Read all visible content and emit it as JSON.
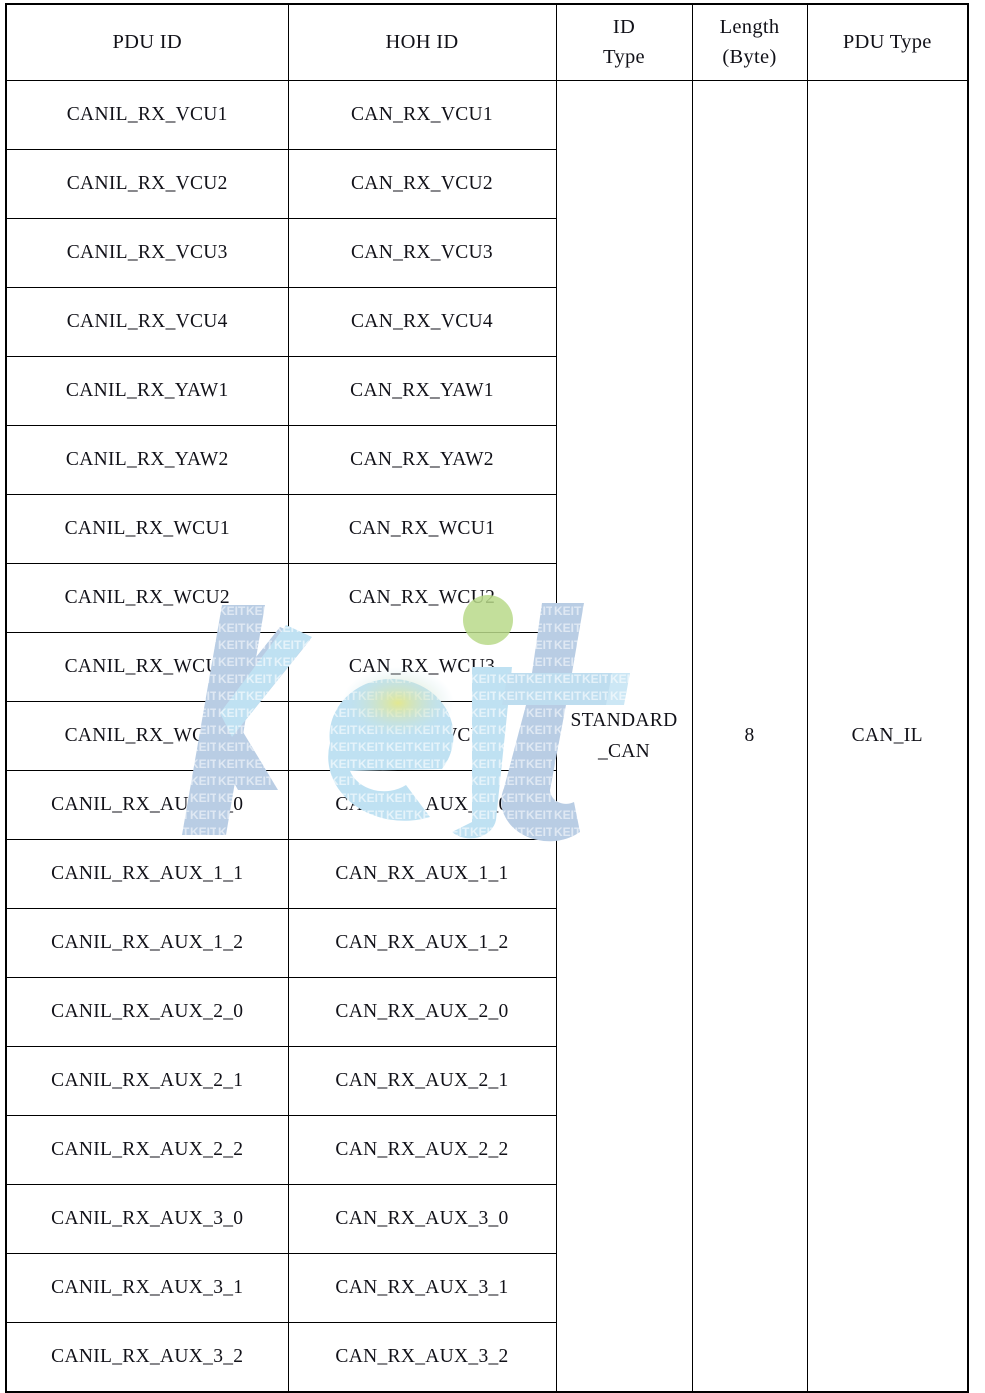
{
  "table": {
    "columns": [
      {
        "key": "pdu_id",
        "label": "PDU ID",
        "lines": [
          "PDU ID"
        ]
      },
      {
        "key": "hoh_id",
        "label": "HOH ID",
        "lines": [
          "HOH ID"
        ]
      },
      {
        "key": "id_type",
        "label": "ID Type",
        "lines": [
          "ID",
          "Type"
        ]
      },
      {
        "key": "length",
        "label": "Length (Byte)",
        "lines": [
          "Length",
          "(Byte)"
        ]
      },
      {
        "key": "pdu_type",
        "label": "PDU Type",
        "lines": [
          "PDU Type"
        ]
      }
    ],
    "header": {
      "pdu_id": "PDU ID",
      "hoh_id": "HOH ID",
      "id_type_line1": "ID",
      "id_type_line2": "Type",
      "length_line1": "Length",
      "length_line2": "(Byte)",
      "pdu_type": "PDU Type"
    },
    "merged": {
      "id_type_line1": "STANDARD",
      "id_type_line2": "_CAN",
      "length": "8",
      "pdu_type": "CAN_IL",
      "rowspan": 20
    },
    "rows": [
      {
        "pdu_id": "CANIL_RX_VCU1",
        "hoh_id": "CAN_RX_VCU1"
      },
      {
        "pdu_id": "CANIL_RX_VCU2",
        "hoh_id": "CAN_RX_VCU2"
      },
      {
        "pdu_id": "CANIL_RX_VCU3",
        "hoh_id": "CAN_RX_VCU3"
      },
      {
        "pdu_id": "CANIL_RX_VCU4",
        "hoh_id": "CAN_RX_VCU4"
      },
      {
        "pdu_id": "CANIL_RX_YAW1",
        "hoh_id": "CAN_RX_YAW1"
      },
      {
        "pdu_id": "CANIL_RX_YAW2",
        "hoh_id": "CAN_RX_YAW2"
      },
      {
        "pdu_id": "CANIL_RX_WCU1",
        "hoh_id": "CAN_RX_WCU1"
      },
      {
        "pdu_id": "CANIL_RX_WCU2",
        "hoh_id": "CAN_RX_WCU2"
      },
      {
        "pdu_id": "CANIL_RX_WCU3",
        "hoh_id": "CAN_RX_WCU3"
      },
      {
        "pdu_id": "CANIL_RX_WCU4",
        "hoh_id": "CAN_RX_WCU4"
      },
      {
        "pdu_id": "CANIL_RX_AUX_1_0",
        "hoh_id": "CAN_RX_AUX_1_0"
      },
      {
        "pdu_id": "CANIL_RX_AUX_1_1",
        "hoh_id": "CAN_RX_AUX_1_1"
      },
      {
        "pdu_id": "CANIL_RX_AUX_1_2",
        "hoh_id": "CAN_RX_AUX_1_2"
      },
      {
        "pdu_id": "CANIL_RX_AUX_2_0",
        "hoh_id": "CAN_RX_AUX_2_0"
      },
      {
        "pdu_id": "CANIL_RX_AUX_2_1",
        "hoh_id": "CAN_RX_AUX_2_1"
      },
      {
        "pdu_id": "CANIL_RX_AUX_2_2",
        "hoh_id": "CAN_RX_AUX_2_2"
      },
      {
        "pdu_id": "CANIL_RX_AUX_3_0",
        "hoh_id": "CAN_RX_AUX_3_0"
      },
      {
        "pdu_id": "CANIL_RX_AUX_3_1",
        "hoh_id": "CAN_RX_AUX_3_1"
      },
      {
        "pdu_id": "CANIL_RX_AUX_3_2",
        "hoh_id": "CAN_RX_AUX_3_2"
      }
    ]
  },
  "watermark": {
    "text": "Keit",
    "tile_text": "KEIT",
    "colors": {
      "blue": "#b9cde4",
      "light_blue": "#bfe1f2",
      "green_dot": "#b9d98a",
      "yellow_accent": "#e2e58a"
    }
  }
}
